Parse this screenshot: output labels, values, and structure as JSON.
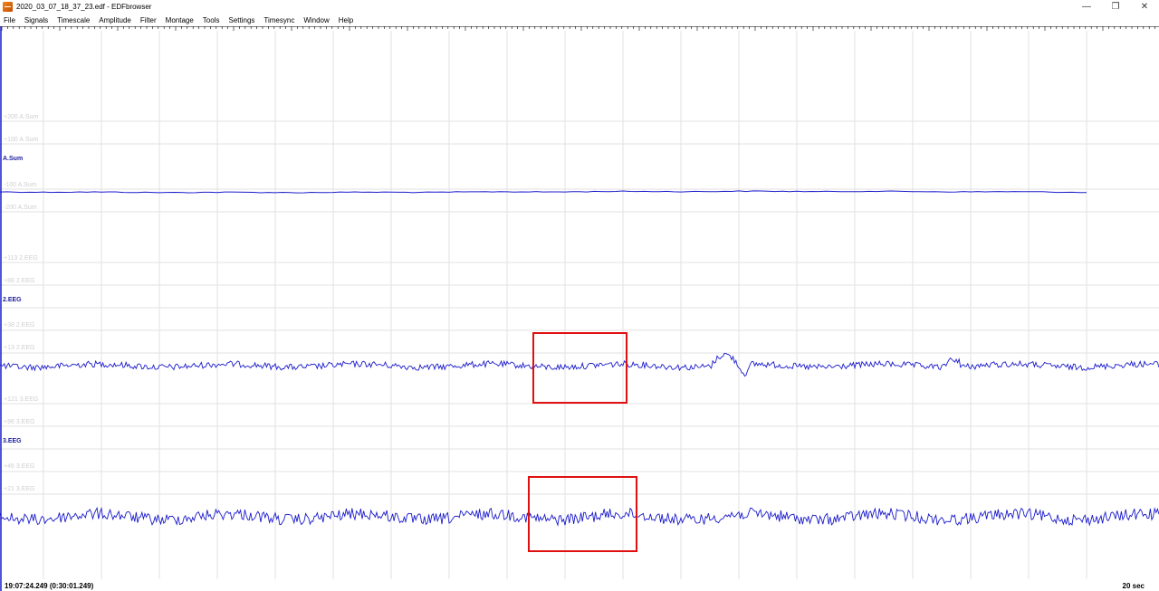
{
  "window": {
    "title": "2020_03_07_18_37_23.edf - EDFbrowser",
    "minimize_glyph": "—",
    "restore_glyph": "❐",
    "close_glyph": "✕"
  },
  "menu": [
    {
      "id": "file",
      "label": "File"
    },
    {
      "id": "signals",
      "label": "Signals"
    },
    {
      "id": "timescale",
      "label": "Timescale"
    },
    {
      "id": "amplitude",
      "label": "Amplitude"
    },
    {
      "id": "filter",
      "label": "Filter"
    },
    {
      "id": "montage",
      "label": "Montage"
    },
    {
      "id": "tools",
      "label": "Tools"
    },
    {
      "id": "settings",
      "label": "Settings"
    },
    {
      "id": "timesync",
      "label": "Timesync"
    },
    {
      "id": "window",
      "label": "Window"
    },
    {
      "id": "help",
      "label": "Help"
    }
  ],
  "signals": [
    {
      "label": "A.Sum",
      "scale_labels": [
        "+200 A.Sum",
        "+100 A.Sum",
        "-100 A.Sum",
        "-200 A.Sum"
      ]
    },
    {
      "label": "2.EEG",
      "scale_labels": [
        "+113 2.EEG",
        "+88 2.EEG",
        "+38 2.EEG",
        "+13 2.EEG"
      ]
    },
    {
      "label": "3.EEG",
      "scale_labels": [
        "+121 3.EEG",
        "+96 3.EEG",
        "+46 3.EEG",
        "+21 3.EEG"
      ]
    }
  ],
  "status": {
    "time": "19:07:24.249 (0:30:01.249)",
    "timescale": "20 sec"
  },
  "colors": {
    "trace": "#1a1acc",
    "grid": "#e2e2e2",
    "scale_text": "#cfcfcf",
    "signal_label": "#1c1c9c",
    "annotation_box": "#e01010"
  }
}
